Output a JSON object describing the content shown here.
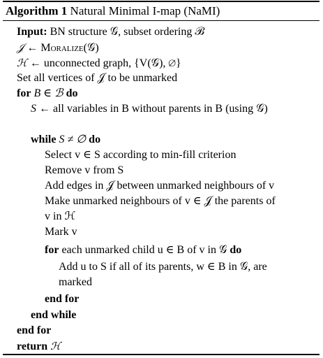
{
  "caption": {
    "label": "Algorithm 1",
    "title": "Natural Minimal I-map (NaMI)"
  },
  "input": {
    "keyword": "Input:",
    "text": "BN structure 𝒢, subset ordering ℬ"
  },
  "step_moralize": {
    "target": "𝒥",
    "op": "Moralize",
    "arg": "(𝒢)"
  },
  "step_init_h": {
    "target": "ℋ",
    "text": "unconnected graph, {V(𝒢), ∅}"
  },
  "step_unmark": "Set all vertices of 𝒥 to be unmarked",
  "for_loop": {
    "keyword": "for",
    "expr": "B ∈ ℬ",
    "do": "do"
  },
  "step_s": {
    "target": "S",
    "text": "all variables in B without parents in B (using 𝒢)"
  },
  "while_loop": {
    "keyword": "while",
    "expr": "S ≠ ∅",
    "do": "do"
  },
  "select": "Select v ∈ S according to min-fill criterion",
  "remove": "Remove v from S",
  "add_edges": "Add edges in 𝒥 between unmarked neighbours of v",
  "make_parents": [
    "Make unmarked neighbours of v ∈ 𝒥 the parents of",
    "v in ℋ"
  ],
  "mark": "Mark v",
  "inner_for": {
    "keyword": "for",
    "text": "each unmarked child u ∈ B of v in 𝒢",
    "do": "do"
  },
  "add_u": [
    "Add u to S if all of its parents, w ∈ B in 𝒢, are",
    "marked"
  ],
  "end_for_inner": "end for",
  "end_while": "end while",
  "end_for_outer": "end for",
  "return": {
    "keyword": "return",
    "value": "ℋ"
  }
}
